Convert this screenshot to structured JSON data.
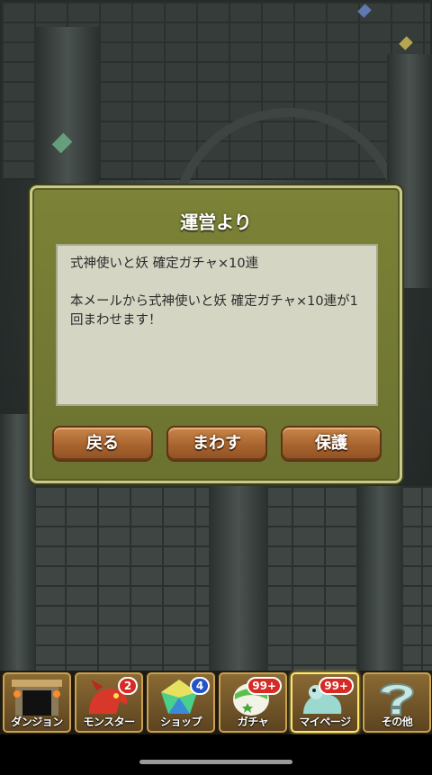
{
  "dialog": {
    "title": "運営より",
    "message_subject": "式神使いと妖 確定ガチャ×10連",
    "message_body": "本メールから式神使いと妖 確定ガチャ×10連が1回まわせます！",
    "buttons": {
      "back": "戻る",
      "spin": "まわす",
      "protect": "保護"
    }
  },
  "nav": {
    "items": [
      {
        "label": "ダンジョン",
        "icon": "dungeon-gate-icon"
      },
      {
        "label": "モンスター",
        "icon": "red-dragon-icon",
        "badge": "2",
        "badge_color": "#d62a24"
      },
      {
        "label": "ショップ",
        "icon": "magic-stone-icon",
        "badge": "4",
        "badge_color": "#2452c8"
      },
      {
        "label": "ガチャ",
        "icon": "egg-icon",
        "badge": "99+",
        "badge_color": "#d62a24"
      },
      {
        "label": "マイページ",
        "icon": "mail-dragon-icon",
        "badge": "99+",
        "badge_color": "#d62a24",
        "active": true
      },
      {
        "label": "その他",
        "icon": "question-icon"
      }
    ]
  },
  "colors": {
    "dialog_bg": "#7c8236",
    "button": "#a8642f",
    "badge_red": "#d62a24",
    "badge_blue": "#2452c8"
  }
}
